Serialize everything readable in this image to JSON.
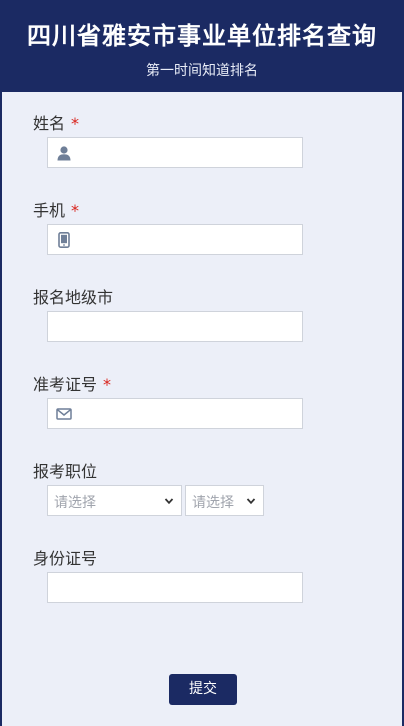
{
  "header": {
    "title": "四川省雅安市事业单位排名查询",
    "subtitle": "第一时间知道排名"
  },
  "form": {
    "name": {
      "label": "姓名",
      "required_mark": "*",
      "icon": "user-icon",
      "value": ""
    },
    "phone": {
      "label": "手机",
      "required_mark": "*",
      "icon": "phone-icon",
      "value": ""
    },
    "city": {
      "label": "报名地级市",
      "value": ""
    },
    "exam_id": {
      "label": "准考证号",
      "required_mark": "*",
      "icon": "envelope-icon",
      "value": ""
    },
    "position": {
      "label": "报考职位",
      "select1_placeholder": "请选择",
      "select2_placeholder": "请选择"
    },
    "id_number": {
      "label": "身份证号",
      "value": ""
    }
  },
  "submit_label": "提交",
  "colors": {
    "primary": "#1b2a63",
    "background": "#eceff8",
    "required": "#d9221b",
    "border": "#cfd3db"
  }
}
